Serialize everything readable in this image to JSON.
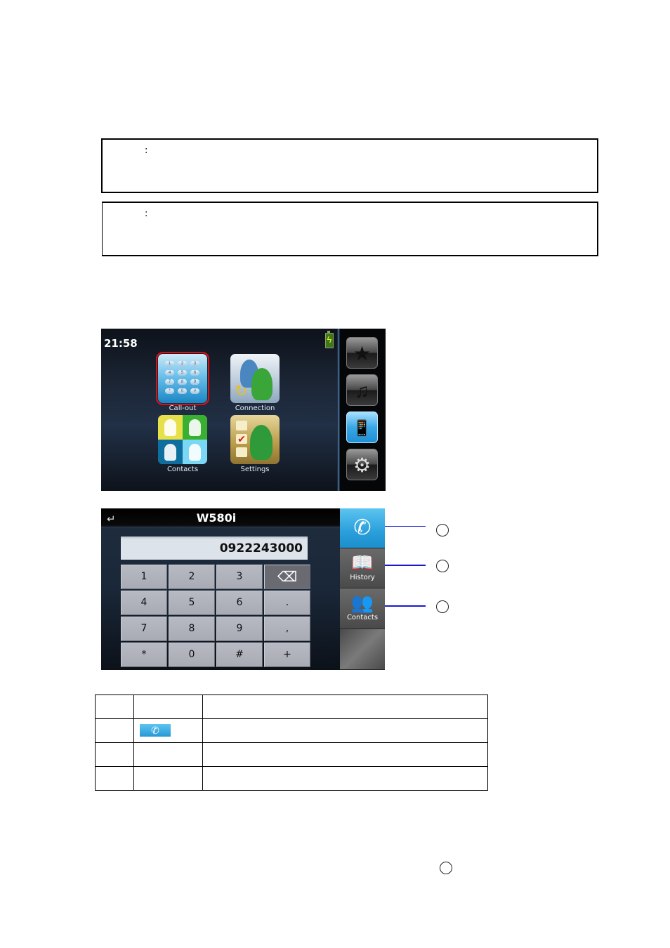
{
  "notes": [
    {
      "marker": ":",
      "text": ""
    },
    {
      "marker": ":",
      "text": ""
    }
  ],
  "home_screen": {
    "clock": "21:58",
    "battery_icon": "charging-battery-icon",
    "apps": [
      {
        "label": "Call-out",
        "icon": "keypad-icon",
        "selected": true
      },
      {
        "label": "Connection",
        "icon": "connection-icon",
        "selected": false
      },
      {
        "label": "Contacts",
        "icon": "contacts-icon",
        "selected": false
      },
      {
        "label": "Settings",
        "icon": "settings-icon",
        "selected": false
      }
    ],
    "keypad_glyphs": [
      "1",
      "2",
      "3",
      "4",
      "5",
      "6",
      "7",
      "8",
      "9",
      "*",
      "0",
      "#"
    ],
    "side_menu": [
      {
        "icon": "favorites-star-icon",
        "glyph": "★",
        "active": false
      },
      {
        "icon": "media-icon",
        "glyph": "♫",
        "active": false
      },
      {
        "icon": "bluetooth-phone-icon",
        "glyph": "📱",
        "active": true
      },
      {
        "icon": "system-settings-icon",
        "glyph": "⚙",
        "active": false
      }
    ]
  },
  "dialer_screen": {
    "back_glyph": "↵",
    "device_name": "W580i",
    "dialed_number": "0922243000",
    "keys": [
      "1",
      "2",
      "3",
      "⌫",
      "4",
      "5",
      "6",
      ".",
      "7",
      "8",
      "9",
      ",",
      "*",
      "0",
      "#",
      "+"
    ],
    "side_buttons": [
      {
        "id": "call",
        "glyph": "✆",
        "label": ""
      },
      {
        "id": "history",
        "glyph": "📖",
        "label": "History"
      },
      {
        "id": "contacts",
        "glyph": "👥",
        "label": "Contacts"
      }
    ]
  },
  "callouts": [
    {
      "marker": ""
    },
    {
      "marker": ""
    },
    {
      "marker": ""
    },
    {
      "marker": ""
    }
  ],
  "legend_table": {
    "rows": [
      {
        "num": "",
        "icon": "",
        "desc": ""
      },
      {
        "num": "",
        "icon": "call-button-icon",
        "desc": ""
      },
      {
        "num": "",
        "icon": "",
        "desc": ""
      },
      {
        "num": "",
        "icon": "",
        "desc": ""
      }
    ],
    "call_glyph": "✆"
  }
}
